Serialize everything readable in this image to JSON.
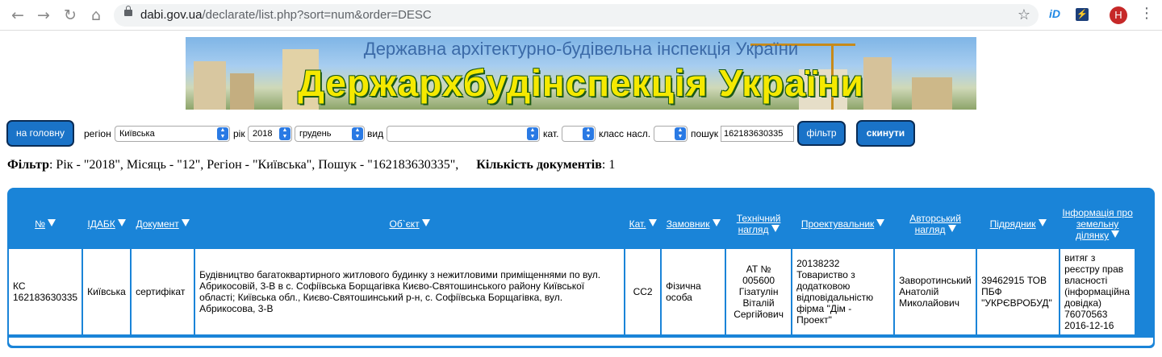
{
  "browser": {
    "url_host": "dabi.gov.ua",
    "url_path": "/declarate/list.php?sort=num&order=DESC",
    "avatar_letter": "H",
    "ext1_label": "iD"
  },
  "banner": {
    "subtitle": "Державна архітектурно-будівельна інспекція України",
    "title": "Держархбудінспекція України"
  },
  "filters": {
    "home_button": "на головну",
    "region_label": "регіон",
    "region_value": "Київська",
    "year_label": "рік",
    "year_value": "2018",
    "month_value": "грудень",
    "type_label": "вид",
    "type_value": "",
    "cat_label": "кат.",
    "cat_value": "",
    "class_label": "класс насл.",
    "class_value": "",
    "search_label": "пошук",
    "search_value": "162183630335",
    "filter_button": "фільтр",
    "reset_button": "скинути"
  },
  "summary": {
    "filter_label": "Фільтр",
    "filter_text": ": Рік - \"2018\", Місяць - \"12\", Регіон - \"Київська\", Пошук - \"162183630335\",",
    "count_label": "Кількість документів",
    "count_value": ": 1"
  },
  "table": {
    "headers": [
      "№",
      "ІДАБК",
      "Документ",
      "Об`єкт",
      "Кат.",
      "Замовник",
      "Технічний нагляд",
      "Проектувальник",
      "Авторський нагляд",
      "Підрядник",
      "Інформація про земельну ділянку"
    ],
    "row": {
      "num": "КС 162183630335",
      "idabk": "Київська",
      "document": "сертифікат",
      "object": "Будівництво багатоквартирного житлового будинку з нежитловими приміщеннями по вул. Абрикосовій, 3-В в с. Софіївська Борщагівка Києво-Святошинського району Київської області; Київська обл., Києво-Святошинський р-н, с. Софіївська Борщагівка, вул. Абрикосова, 3-В",
      "category": "СС2",
      "customer": "Фізична особа",
      "tech_supervision": "АТ № 005600 Гізатулін Віталій Сергійович",
      "designer": "20138232 Товариство з додатковою відповідальністю фірма \"Дім - Проект\"",
      "author_supervision": "Заворотинський Анатолій Миколайович",
      "contractor": "39462915 ТОВ ПБФ \"УКРЄВРОБУД\"",
      "land_info": "витяг з реєстру прав власності (інформаційна довідка) 76070563 2016-12-16"
    }
  }
}
